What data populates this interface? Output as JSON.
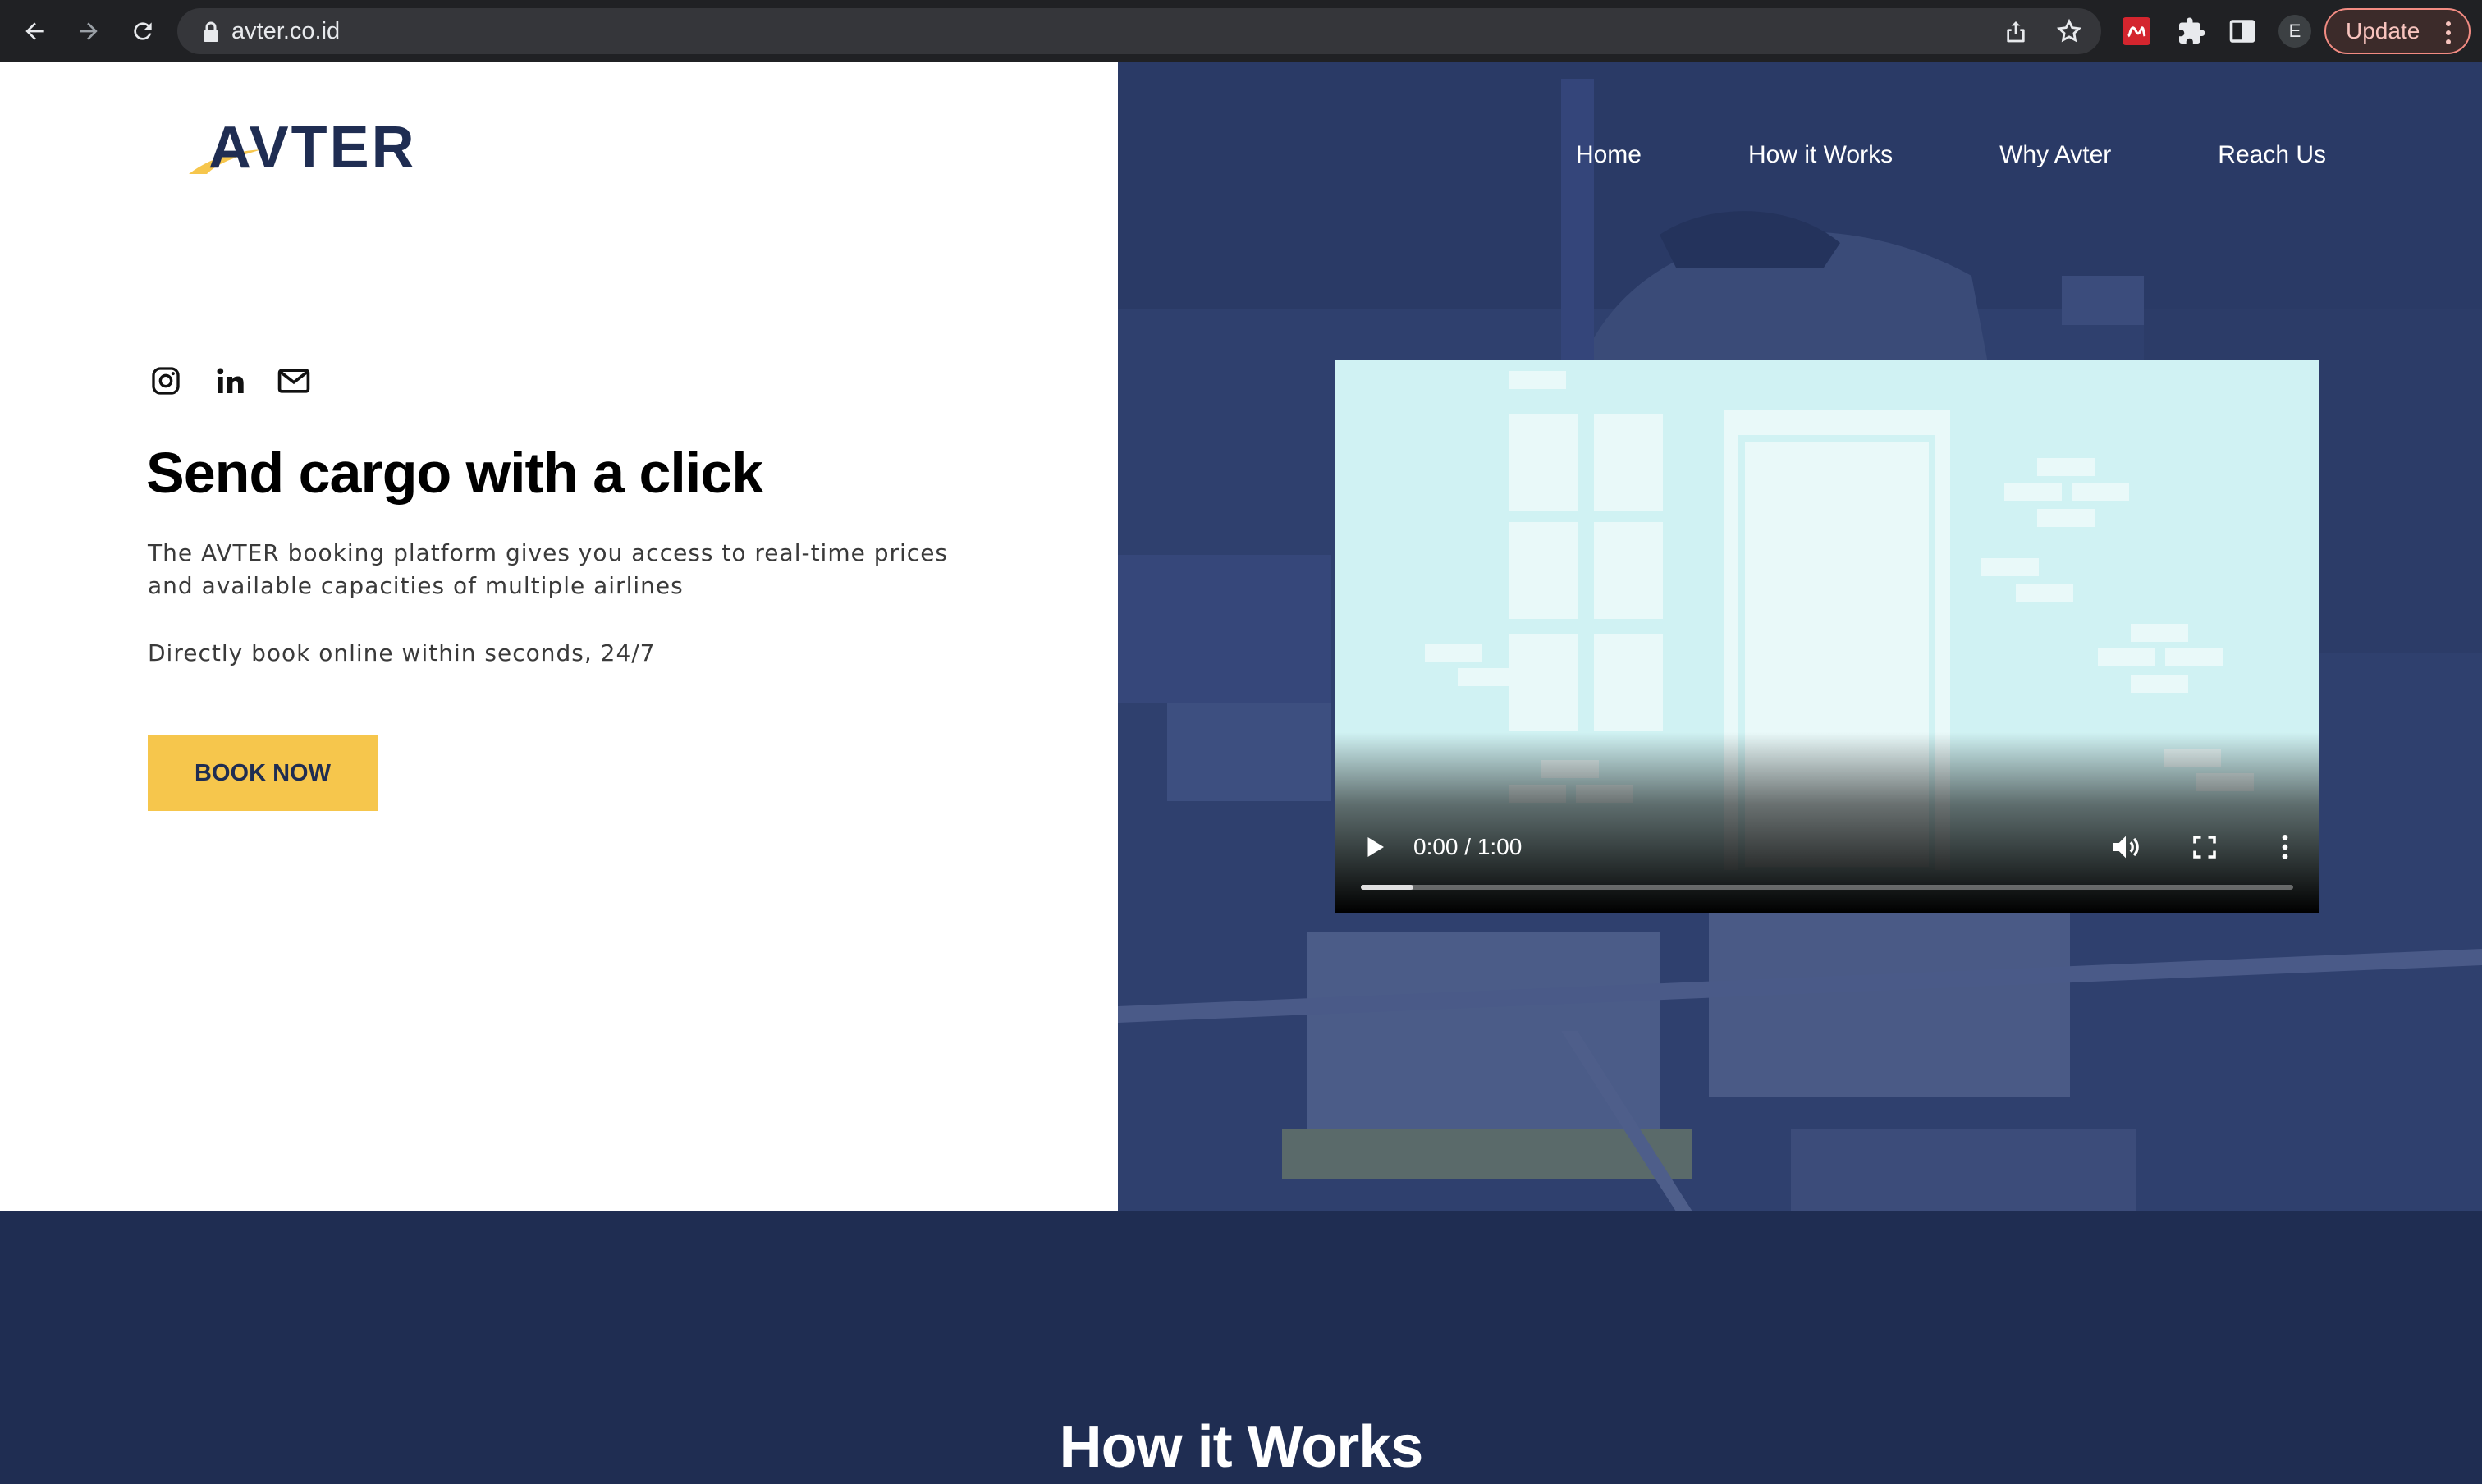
{
  "browser": {
    "url": "avter.co.id",
    "profile_initial": "E",
    "update_label": "Update"
  },
  "site": {
    "logo_text": "AVTER",
    "nav": [
      "Home",
      "How it Works",
      "Why Avter",
      "Reach Us"
    ],
    "hero": {
      "title": "Send cargo with a click",
      "description": "The AVTER booking platform gives you access to real-time prices and available capacities of multiple airlines",
      "description2": "Directly book online within seconds, 24/7",
      "cta_label": "BOOK NOW"
    },
    "video": {
      "time": "0:00 / 1:00",
      "progress_fraction": 0
    },
    "section_title": "How it Works"
  },
  "icons": {
    "socials": [
      "instagram-icon",
      "linkedin-icon",
      "mail-icon"
    ]
  },
  "colors": {
    "brand_navy": "#1f2d52",
    "accent_yellow": "#f6c64c",
    "hero_overlay": "#2e3f6d",
    "video_bg": "#d0f2f3"
  }
}
